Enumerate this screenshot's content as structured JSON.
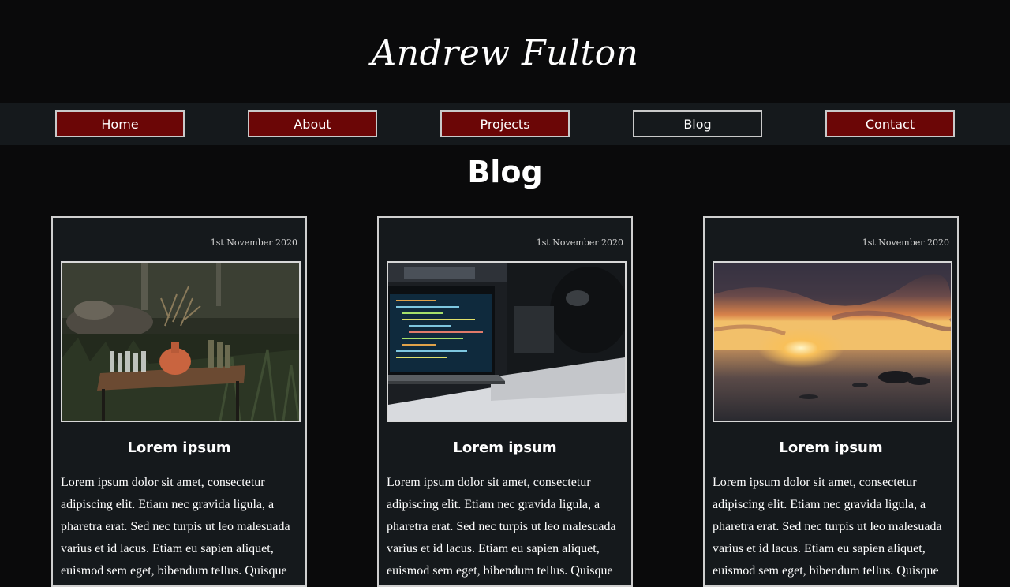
{
  "header": {
    "title": "Andrew Fulton"
  },
  "nav": {
    "items": [
      {
        "label": "Home",
        "active": false
      },
      {
        "label": "About",
        "active": false
      },
      {
        "label": "Projects",
        "active": false
      },
      {
        "label": "Blog",
        "active": true
      },
      {
        "label": "Contact",
        "active": false
      }
    ]
  },
  "page": {
    "heading": "Blog"
  },
  "posts": [
    {
      "date": "1st November 2020",
      "image": "garden-table-vase-photo",
      "title": "Lorem ipsum",
      "excerpt": "Lorem ipsum dolor sit amet, consectetur adipiscing elit. Etiam nec gravida ligula, a pharetra erat. Sed nec turpis ut leo malesuada varius et id lacus. Etiam eu sapien aliquet, euismod sem eget, bibendum tellus. Quisque"
    },
    {
      "date": "1st November 2020",
      "image": "laptop-code-photo",
      "title": "Lorem ipsum",
      "excerpt": "Lorem ipsum dolor sit amet, consectetur adipiscing elit. Etiam nec gravida ligula, a pharetra erat. Sed nec turpis ut leo malesuada varius et id lacus. Etiam eu sapien aliquet, euismod sem eget, bibendum tellus. Quisque"
    },
    {
      "date": "1st November 2020",
      "image": "sunset-sea-photo",
      "title": "Lorem ipsum",
      "excerpt": "Lorem ipsum dolor sit amet, consectetur adipiscing elit. Etiam nec gravida ligula, a pharetra erat. Sed nec turpis ut leo malesuada varius et id lacus. Etiam eu sapien aliquet, euismod sem eget, bibendum tellus. Quisque"
    }
  ],
  "colors": {
    "background": "#0a0a0b",
    "navbar": "#15191c",
    "button": "#6b0606",
    "card": "#15191c",
    "border": "#cfcfcf"
  }
}
